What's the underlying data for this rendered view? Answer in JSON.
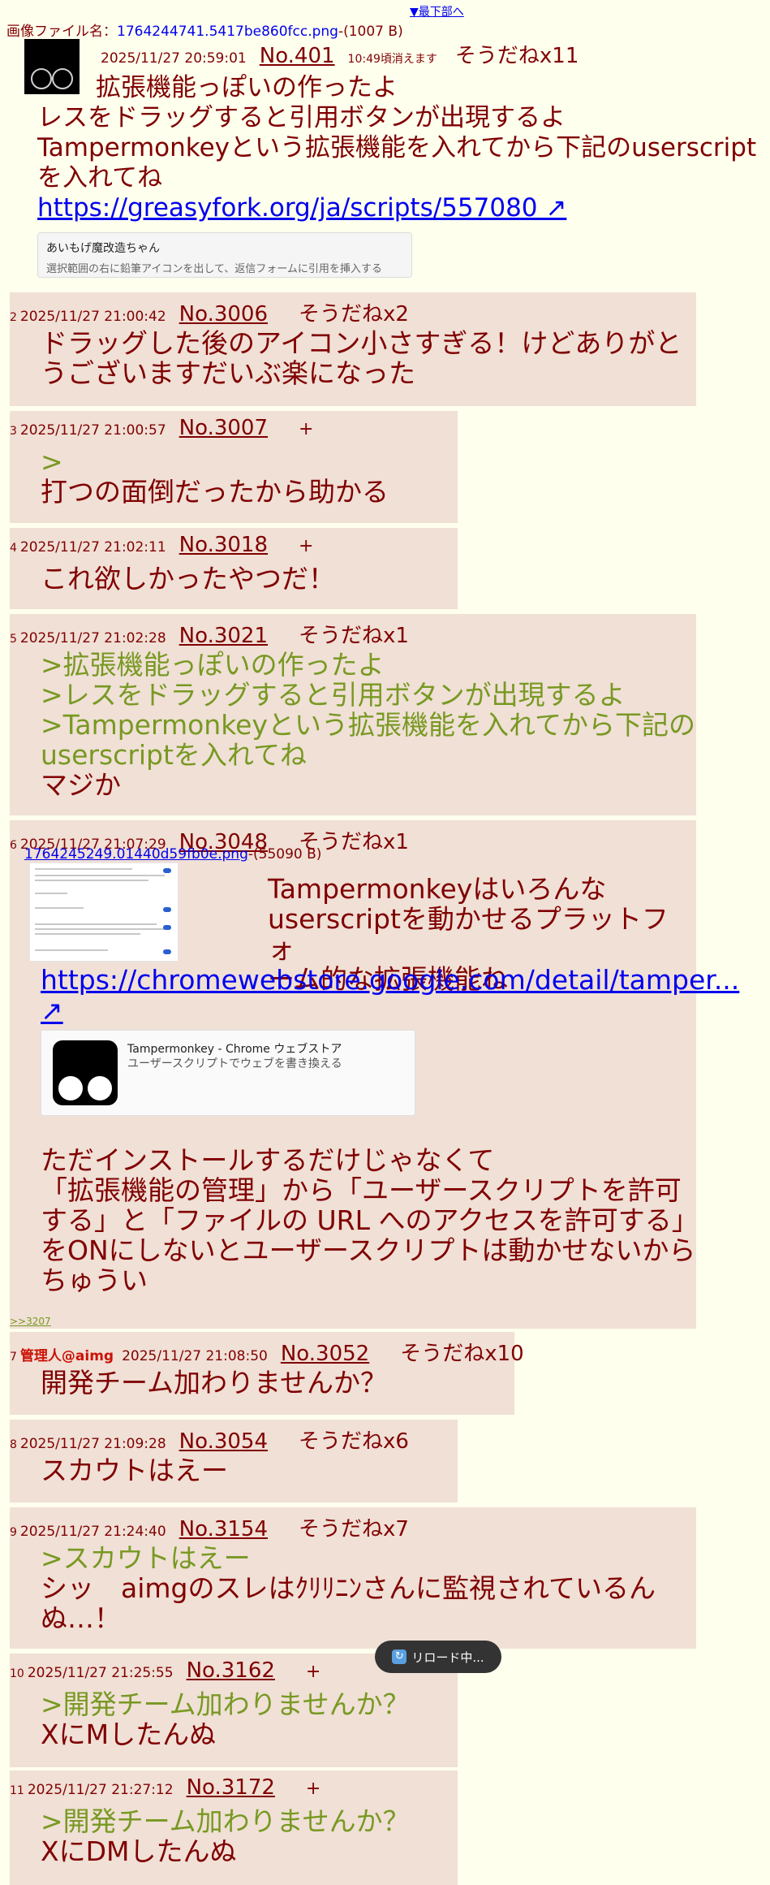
{
  "nav": {
    "to_bottom": "▼最下部へ"
  },
  "op": {
    "file_label": "画像ファイル名：",
    "file_name": "1764244741.5417be860fcc.png",
    "file_size": "-(1007 B)",
    "date": "2025/11/27 20:59:01",
    "no": "No.401",
    "disappear": "10:49頃消えます",
    "sodane": "そうだねx11",
    "lines": [
      "拡張機能っぽいの作ったよ",
      "レスをドラッグすると引用ボタンが出現するよ",
      "Tampermonkeyという拡張機能を入れてから下記のuserscript",
      "を入れてね"
    ],
    "link": "https://greasyfork.org/ja/scripts/557080 ↗",
    "card": {
      "title": "あいもげ魔改造ちゃん",
      "desc": "選択範囲の右に鉛筆アイコンを出して、返信フォームに引用を挿入する"
    }
  },
  "replies": [
    {
      "num": "2",
      "date": "2025/11/27 21:00:42",
      "no": "No.3006",
      "sodane": "そうだねx2",
      "lines": [
        {
          "t": "ドラッグした後のアイコン小さすぎる！けどありがと",
          "q": false
        },
        {
          "t": "うございますだいぶ楽になった",
          "q": false
        }
      ]
    },
    {
      "num": "3",
      "date": "2025/11/27 21:00:57",
      "no": "No.3007",
      "sodane": "+",
      "lines": [
        {
          "t": ">",
          "q": true
        },
        {
          "t": "打つの面倒だったから助かる",
          "q": false
        }
      ]
    },
    {
      "num": "4",
      "date": "2025/11/27 21:02:11",
      "no": "No.3018",
      "sodane": "+",
      "lines": [
        {
          "t": "これ欲しかったやつだ！",
          "q": false
        }
      ]
    },
    {
      "num": "5",
      "date": "2025/11/27 21:02:28",
      "no": "No.3021",
      "sodane": "そうだねx1",
      "lines": [
        {
          "t": ">拡張機能っぽいの作ったよ",
          "q": true
        },
        {
          "t": ">レスをドラッグすると引用ボタンが出現するよ",
          "q": true
        },
        {
          "t": ">Tampermonkeyという拡張機能を入れてから下記の",
          "q": true
        },
        {
          "t": "userscriptを入れてね",
          "q": true
        },
        {
          "t": "マジか",
          "q": false
        }
      ]
    },
    {
      "num": "6",
      "date": "2025/11/27 21:07:29",
      "no": "No.3048",
      "sodane": "そうだねx1",
      "file_name": "1764245249.01440d59fb0e.png",
      "file_size": "-(55090 B)",
      "text_lines": [
        "Tampermonkeyはいろんな",
        "userscriptを動かせるプラットフォ",
        "ーム的な拡張機能ね"
      ],
      "link": "https://chromewebstore.google.com/detail/tamper...",
      "link_arrow": "↗",
      "card": {
        "title": "Tampermonkey - Chrome ウェブストア",
        "desc": "ユーザースクリプトでウェブを書き換える"
      },
      "body2": [
        "ただインストールするだけじゃなくて",
        "「拡張機能の管理」から「ユーザースクリプトを許可",
        "する」と「ファイルの URL へのアクセスを許可する」",
        "をONにしないとユーザースクリプトは動かせないから",
        "ちゅうい"
      ],
      "backlink": ">>3207"
    },
    {
      "num": "7",
      "name": "管理人@aimg",
      "date": "2025/11/27 21:08:50",
      "no": "No.3052",
      "sodane": "そうだねx10",
      "lines": [
        {
          "t": "開発チーム加わりませんか？",
          "q": false
        }
      ]
    },
    {
      "num": "8",
      "date": "2025/11/27 21:09:28",
      "no": "No.3054",
      "sodane": "そうだねx6",
      "lines": [
        {
          "t": "スカウトはえー",
          "q": false
        }
      ]
    },
    {
      "num": "9",
      "date": "2025/11/27 21:24:40",
      "no": "No.3154",
      "sodane": "そうだねx7",
      "lines": [
        {
          "t": ">スカウトはえー",
          "q": true
        },
        {
          "t": "シッ　aimgのスレはｸﾘﾘﾆﾝさんに監視されているん",
          "q": false
        },
        {
          "t": "ぬ…！",
          "q": false
        }
      ]
    },
    {
      "num": "10",
      "date": "2025/11/27 21:25:55",
      "no": "No.3162",
      "sodane": "+",
      "lines": [
        {
          "t": ">開発チーム加わりませんか？",
          "q": true
        },
        {
          "t": "XにMしたんぬ",
          "q": false
        }
      ]
    },
    {
      "num": "11",
      "date": "2025/11/27 21:27:12",
      "no": "No.3172",
      "sodane": "+",
      "lines": [
        {
          "t": ">開発チーム加わりませんか？",
          "q": true
        },
        {
          "t": "XにDMしたんぬ",
          "q": false
        }
      ]
    }
  ],
  "toast": {
    "icon": "reload-icon",
    "text": "リロード中..."
  }
}
